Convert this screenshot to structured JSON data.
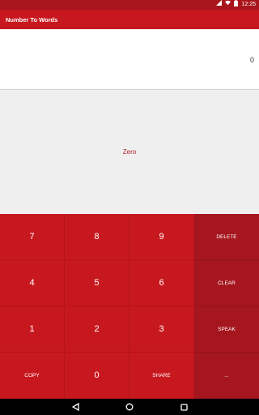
{
  "status_bar": {
    "time": "12:25",
    "icons": [
      "wifi-icon",
      "signal-icon",
      "battery-icon"
    ]
  },
  "app_bar": {
    "title": "Number To Words"
  },
  "display": {
    "number": "0",
    "words": "Zero"
  },
  "keypad": {
    "rows": [
      [
        "7",
        "8",
        "9",
        "DELETE"
      ],
      [
        "4",
        "5",
        "6",
        "CLEAR"
      ],
      [
        "1",
        "2",
        "3",
        "SPEAK"
      ],
      [
        "COPY",
        "0",
        "SHARE",
        "..."
      ]
    ]
  },
  "nav_bar": {
    "icons": [
      "back-icon",
      "home-icon",
      "recents-icon"
    ]
  },
  "colors": {
    "primary": "#c8181f",
    "primary_dark": "#a8151c",
    "function_keys": "#a5161e",
    "words_text": "#a81f24",
    "words_bg": "#efefef"
  }
}
